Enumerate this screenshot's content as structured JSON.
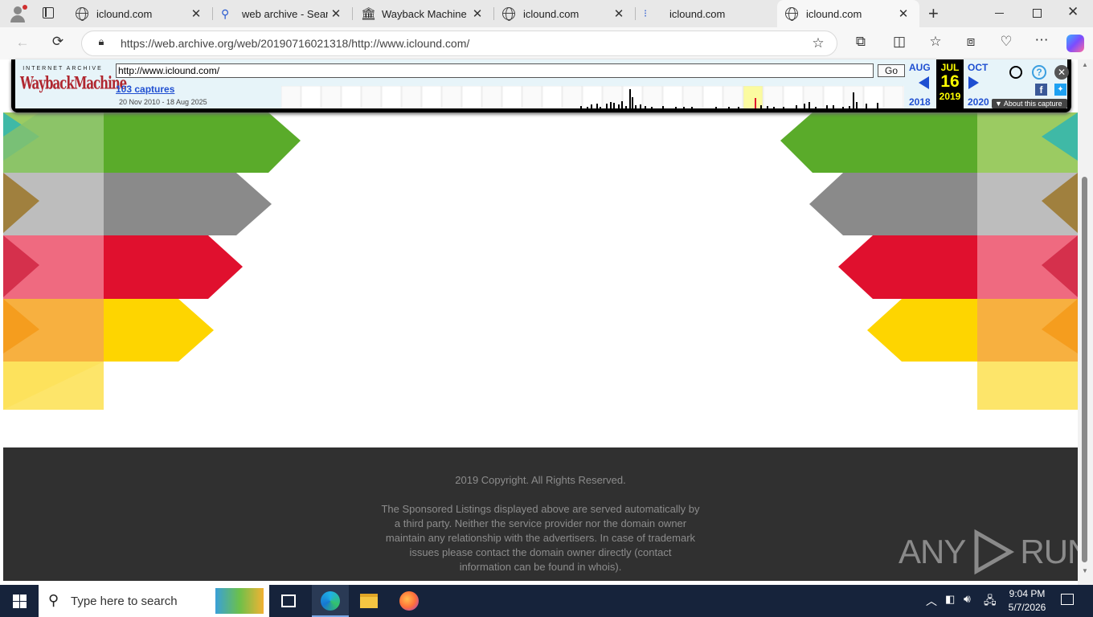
{
  "browser": {
    "tabs": [
      {
        "label": "iclound.com",
        "icon": "globe-icon",
        "active": false
      },
      {
        "label": "web archive - Search",
        "icon": "search-icon",
        "active": false
      },
      {
        "label": "Wayback Machine - C",
        "icon": "archive-icon",
        "active": false
      },
      {
        "label": "iclound.com",
        "icon": "globe-icon",
        "active": false
      },
      {
        "label": "iclound.com",
        "icon": "loading-icon",
        "active": false
      },
      {
        "label": "iclound.com",
        "icon": "globe-icon",
        "active": true
      }
    ],
    "url": "https://web.archive.org/web/20190716021318/http://www.iclound.com/"
  },
  "wayback": {
    "logo_top": "INTERNET ARCHIVE",
    "logo_main": "WaybackMachine",
    "url_value": "http://www.iclound.com/",
    "go_label": "Go",
    "captures_link": "103 captures",
    "captures_range": "20 Nov 2010 - 18 Aug 2025",
    "prev_month": "AUG",
    "cur_month": "JUL",
    "next_month": "OCT",
    "cur_day": "16",
    "prev_year": "2018",
    "cur_year": "2019",
    "next_year": "2020",
    "about_label": "About this capture"
  },
  "footer": {
    "copyright": "2019 Copyright. All Rights Reserved.",
    "disclaimer_lines": [
      "The Sponsored Listings displayed above are served automatically by",
      "a third party. Neither the service provider nor the domain owner",
      "maintain any relationship with the advertisers. In case of trademark",
      "issues please contact the domain owner directly (contact",
      "information can be found in whois)."
    ]
  },
  "watermark": {
    "left": "ANY",
    "right": "RUN"
  },
  "taskbar": {
    "search_placeholder": "Type here to search",
    "time": "9:04 PM",
    "date": "5/7/2026"
  },
  "colors": {
    "green": "#5aab2a",
    "gray": "#8a8a8a",
    "red": "#e0102e",
    "yellow": "#fed500",
    "wayback_blue": "#1f4fd1",
    "footer_bg": "#303030"
  }
}
